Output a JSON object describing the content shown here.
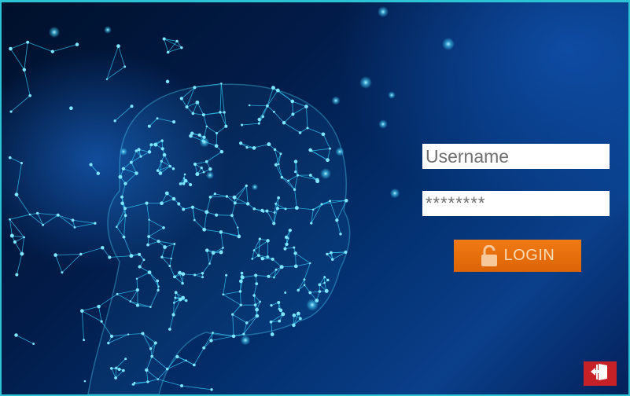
{
  "login": {
    "username_placeholder": "Username",
    "password_value": "********",
    "login_label": "LOGIN"
  },
  "icons": {
    "lock": "unlock-icon",
    "exit": "exit-door-icon",
    "background": "polygon-face-illustration"
  },
  "colors": {
    "background_dark": "#00102a",
    "background_light": "#0a3f8a",
    "mesh": "#35d4ff",
    "login_button": "#e87012",
    "login_text": "#f7ddb8",
    "exit_button": "#c62127",
    "frame_border": "#2cc4d4"
  }
}
